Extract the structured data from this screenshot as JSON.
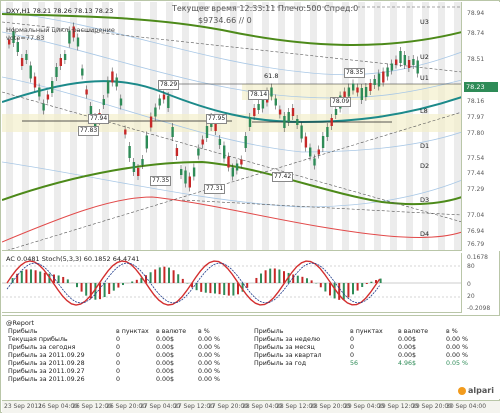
{
  "chart": {
    "symbol_line": "DXY,H1  78.21 78.26 78.13 78.23",
    "hint_text": "Нормальный цикл, расширение",
    "vote_text": "vote=77.83",
    "header_line1": "Текущее время 12:33:11 Плечо:500 Спред:0",
    "header_line2": "$9734.66  // 0",
    "current_price": "78.23",
    "level_labels": {
      "u3": "U3",
      "u2": "U2",
      "u1": "U1",
      "l8": "L8",
      "d1": "D1",
      "d2": "D2",
      "d3": "D3",
      "d4": "D4",
      "sixty_one_eight": "61.8"
    },
    "price_boxes": [
      "78.35",
      "78.29",
      "78.14",
      "78.09",
      "77.95",
      "77.94",
      "77.83",
      "77.35",
      "77.31",
      "77.42"
    ],
    "axis_ticks": [
      "78.94",
      "78.74",
      "78.51",
      "78.23",
      "78.16",
      "77.97",
      "77.80",
      "77.54",
      "77.44",
      "77.29",
      "77.04",
      "76.94",
      "76.79"
    ],
    "colors": {
      "ema_teal": "#1c8a8a",
      "bands_green": "#4d8a1a",
      "candle_up": "#2e8b57",
      "candle_down": "#c62828",
      "red_curve": "#e24a4a"
    }
  },
  "indicator": {
    "title": "AC 0.0481  Stoch(5,3,3) 60.1852 64.4741",
    "axis_ticks": [
      "0.1678",
      "80",
      "20",
      "0",
      "-0.2098"
    ]
  },
  "report": {
    "title": "@Report",
    "columns_left": [
      "Прибыль",
      "в пунктах",
      "в валюте",
      "в %"
    ],
    "rows_left": [
      [
        "Текущая прибыль",
        "0",
        "0.00$",
        "0.00 %"
      ],
      [
        "Прибыль за сегодня",
        "0",
        "0.00$",
        "0.00 %"
      ],
      [
        "Прибыль за 2011.09.29",
        "0",
        "0.00$",
        "0.00 %"
      ],
      [
        "Прибыль за 2011.09.28",
        "0",
        "0.00$",
        "0.00 %"
      ],
      [
        "Прибыль за 2011.09.27",
        "0",
        "0.00$",
        "0.00 %"
      ],
      [
        "Прибыль за 2011.09.26",
        "0",
        "0.00$",
        "0.00 %"
      ]
    ],
    "columns_right": [
      "Прибыль",
      "в пунктах",
      "в валюте",
      "в %"
    ],
    "rows_right": [
      [
        "Прибыль за неделю",
        "0",
        "0.00$",
        "0.00 %"
      ],
      [
        "Прибыль за месяц",
        "0",
        "0.00$",
        "0.00 %"
      ],
      [
        "Прибыль за квартал",
        "0",
        "0.00$",
        "0.00 %"
      ],
      [
        "Прибыль за год",
        "56",
        "4.96$",
        "0.05 %"
      ]
    ],
    "logo": "alpari"
  },
  "time_axis": [
    "23 Sep 2011",
    "26 Sep 04:00",
    "26 Sep 12:00",
    "26 Sep 20:00",
    "27 Sep 04:00",
    "27 Sep 12:00",
    "27 Sep 20:00",
    "28 Sep 04:00",
    "28 Sep 12:00",
    "28 Sep 20:00",
    "29 Sep 04:00",
    "29 Sep 12:00",
    "29 Sep 20:00",
    "30 Sep 04:00"
  ]
}
